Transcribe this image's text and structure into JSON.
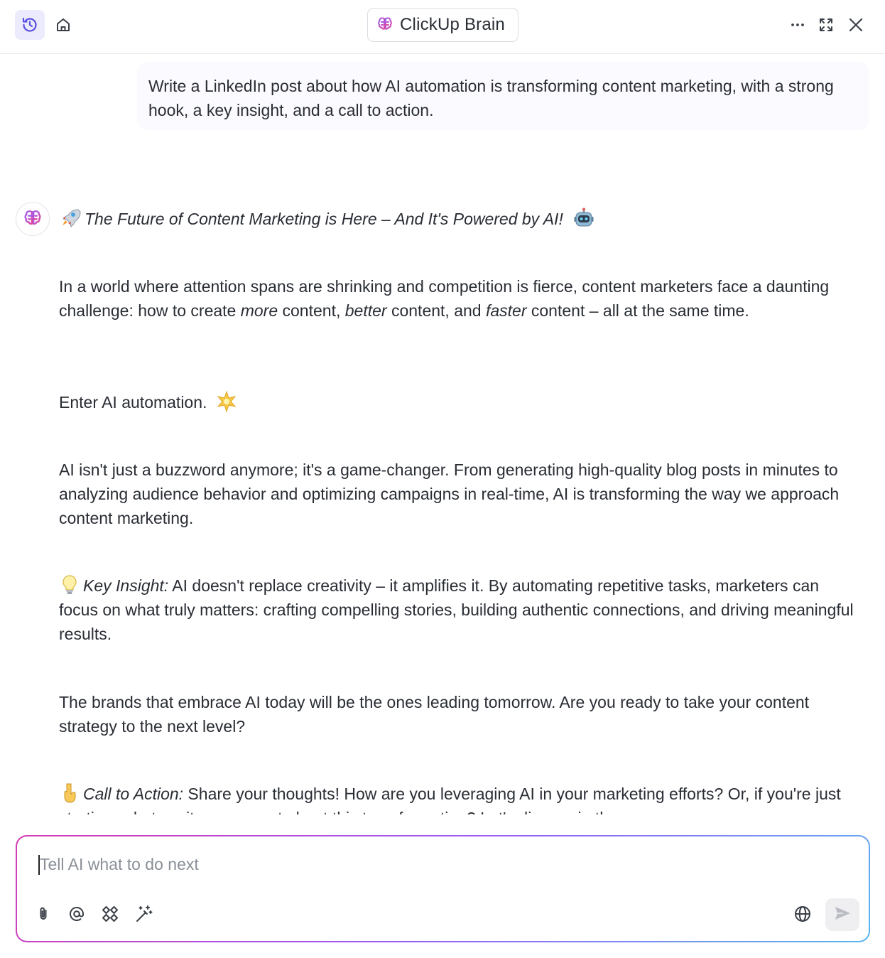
{
  "header": {
    "title": "ClickUp Brain"
  },
  "user_message": "Write a LinkedIn post about how AI automation is transforming content marketing, with a strong hook, a key insight, and a call to action.",
  "response": {
    "headline": "The Future of Content Marketing is Here – And It's Powered by AI!",
    "p1_a": "In a world where attention spans are shrinking and competition is fierce, content marketers face a daunting challenge: how to create ",
    "p1_more": "more",
    "p1_b": " content, ",
    "p1_better": "better",
    "p1_c": " content, and ",
    "p1_faster": "faster",
    "p1_d": " content – all at the same time.",
    "p2": "Enter AI automation.",
    "p3": "AI isn't just a buzzword anymore; it's a game-changer. From generating high-quality blog posts in minutes to analyzing audience behavior and optimizing campaigns in real-time, AI is transforming the way we approach content marketing.",
    "insight_label": "Key Insight:",
    "insight_text": " AI doesn't replace creativity – it amplifies it. By automating repetitive tasks, marketers can focus on what truly matters: crafting compelling stories, building authentic connections, and driving meaningful results.",
    "p5": "The brands that embrace AI today will be the ones leading tomorrow. Are you ready to take your content strategy to the next level?",
    "cta_label": "Call to Action:",
    "cta_text": " Share your thoughts! How are you leveraging AI in your marketing efforts? Or, if you're just starting, what excites you most about this transformation? Let's discuss in the"
  },
  "composer": {
    "placeholder": "Tell AI what to do next"
  },
  "colors": {
    "brand_pink": "#d63ab4",
    "brand_purple": "#9b5cf3",
    "brand_blue": "#5ab8ee",
    "history_bg": "#ebebfd"
  },
  "icons": [
    "history-icon",
    "home-icon",
    "brain-logo-icon",
    "more-icon",
    "expand-icon",
    "close-icon",
    "rocket-emoji-icon",
    "robot-emoji-icon",
    "sparkle-emoji-icon",
    "lightbulb-emoji-icon",
    "pointing-down-emoji-icon",
    "attach-icon",
    "mention-icon",
    "apps-icon",
    "magic-icon",
    "globe-icon",
    "send-icon"
  ]
}
